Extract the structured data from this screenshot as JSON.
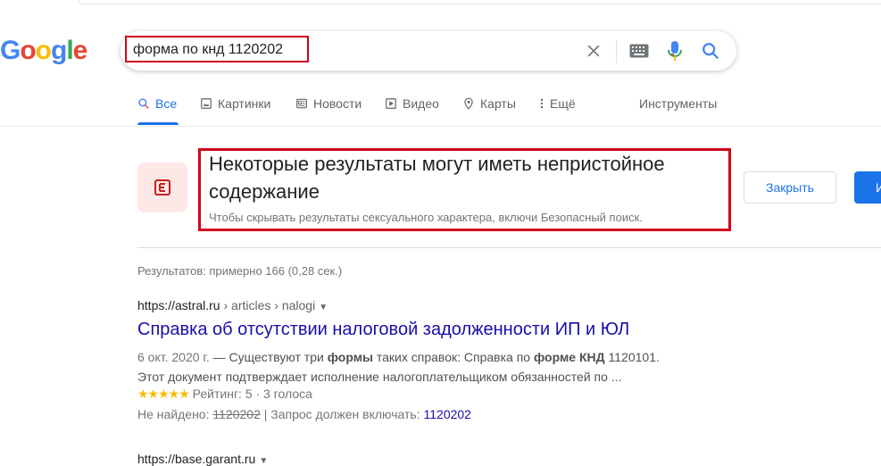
{
  "logo": {
    "letters": [
      "G",
      "o",
      "o",
      "g",
      "l",
      "e"
    ],
    "colors": [
      "#4285f4",
      "#ea4335",
      "#fbbc05",
      "#4285f4",
      "#34a853",
      "#ea4335"
    ]
  },
  "search": {
    "query": "форма по кнд 1120202"
  },
  "tabs": [
    {
      "label": "Все",
      "icon": "search-icon",
      "active": true
    },
    {
      "label": "Картинки",
      "icon": "image-icon"
    },
    {
      "label": "Новости",
      "icon": "news-icon"
    },
    {
      "label": "Видео",
      "icon": "play-icon"
    },
    {
      "label": "Карты",
      "icon": "map-pin-icon"
    },
    {
      "label": "Ещё",
      "icon": "more-vert-icon"
    }
  ],
  "tools_label": "Инструменты",
  "safe_search": {
    "title": "Некоторые результаты могут иметь непристойное содержание",
    "subtitle": "Чтобы скрывать результаты сексуального характера, включи Безопасный поиск.",
    "close_label": "Закрыть",
    "enable_label": "И",
    "icon_letter": "E"
  },
  "stats": "Результатов: примерно 166 (0,28 сек.)",
  "results": [
    {
      "site": "https://astral.ru",
      "path": " › articles › nalogi",
      "title": "Справка об отсутствии налоговой задолженности ИП и ЮЛ",
      "date": "6 окт. 2020 г.",
      "snippet_a": " — Существуют три ",
      "snippet_b": "формы",
      "snippet_c": " таких справок: Справка по ",
      "snippet_d": "форме КНД",
      "snippet_e": " 1120101.",
      "snippet_line2": "Этот документ подтверждает исполнение налогоплательщиком обязанностей по ...",
      "stars": "★★★★★",
      "rating_text": " Рейтинг: 5 · 3 голоса",
      "missing_label": "Не найдено: ",
      "missing_term": "1120202",
      "must_include": " | Запрос должен включать: ",
      "must_include_term": "1120202"
    },
    {
      "site": "https://base.garant.ru"
    }
  ]
}
